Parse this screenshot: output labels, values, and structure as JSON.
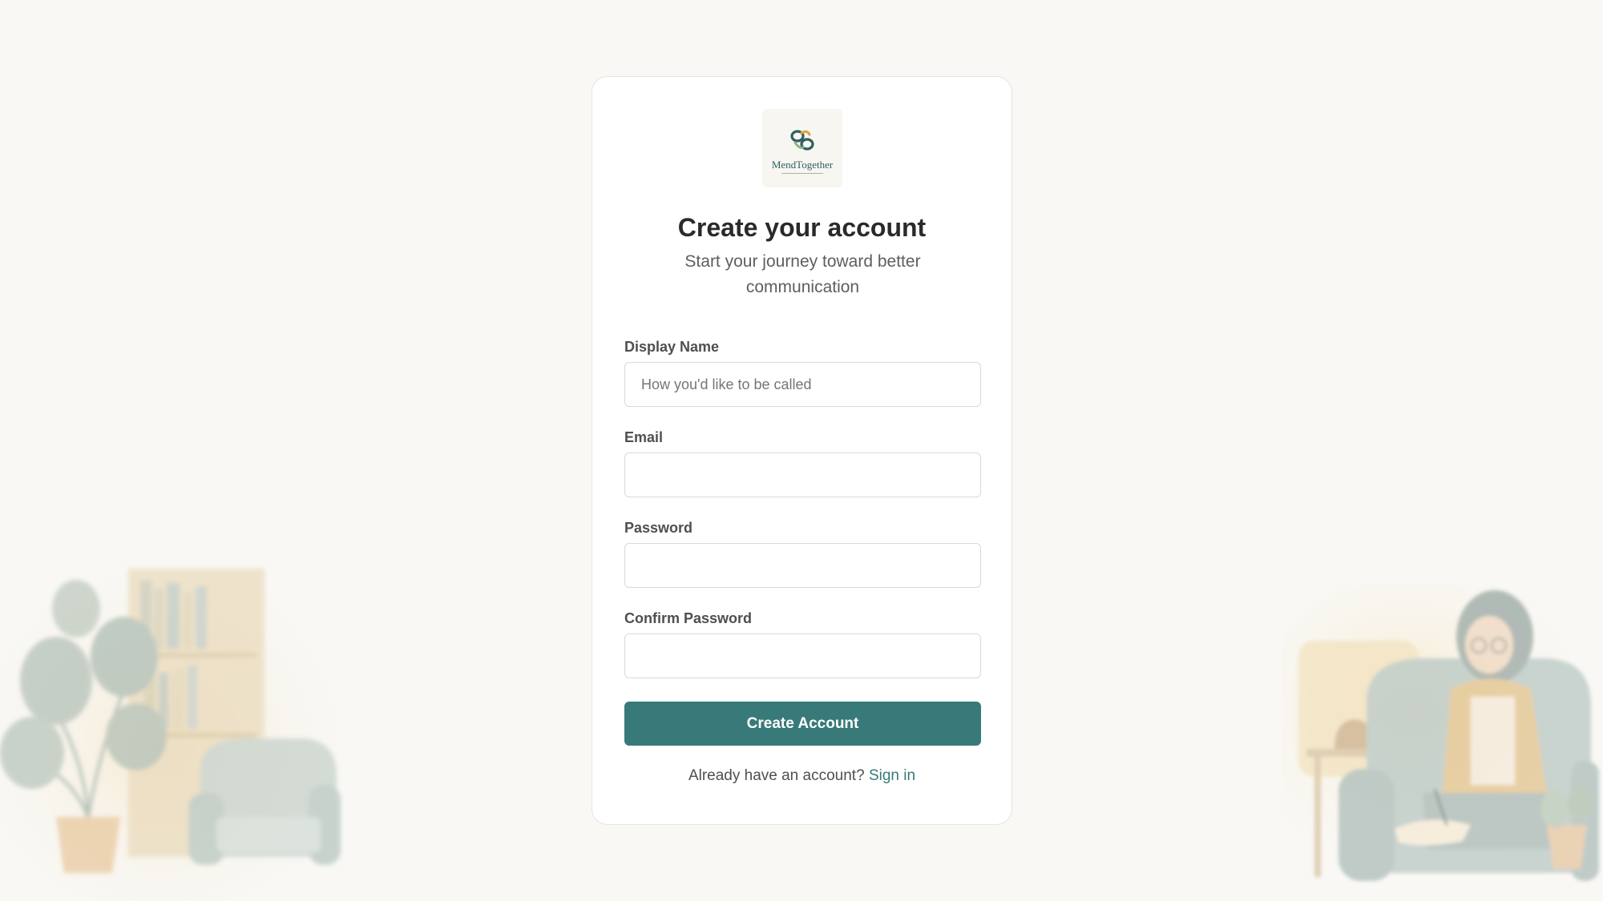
{
  "brand": {
    "logo_text": "MendTogether"
  },
  "header": {
    "title": "Create your account",
    "subtitle": "Start your journey toward better communication"
  },
  "form": {
    "display_name": {
      "label": "Display Name",
      "placeholder": "How you'd like to be called",
      "value": ""
    },
    "email": {
      "label": "Email",
      "placeholder": "",
      "value": ""
    },
    "password": {
      "label": "Password",
      "placeholder": "",
      "value": ""
    },
    "confirm_password": {
      "label": "Confirm Password",
      "placeholder": "",
      "value": ""
    },
    "submit_label": "Create Account"
  },
  "footer": {
    "prompt": "Already have an account?",
    "signin_link": "Sign in"
  },
  "colors": {
    "accent": "#387a79",
    "background": "#f9f8f5",
    "card": "#ffffff"
  }
}
